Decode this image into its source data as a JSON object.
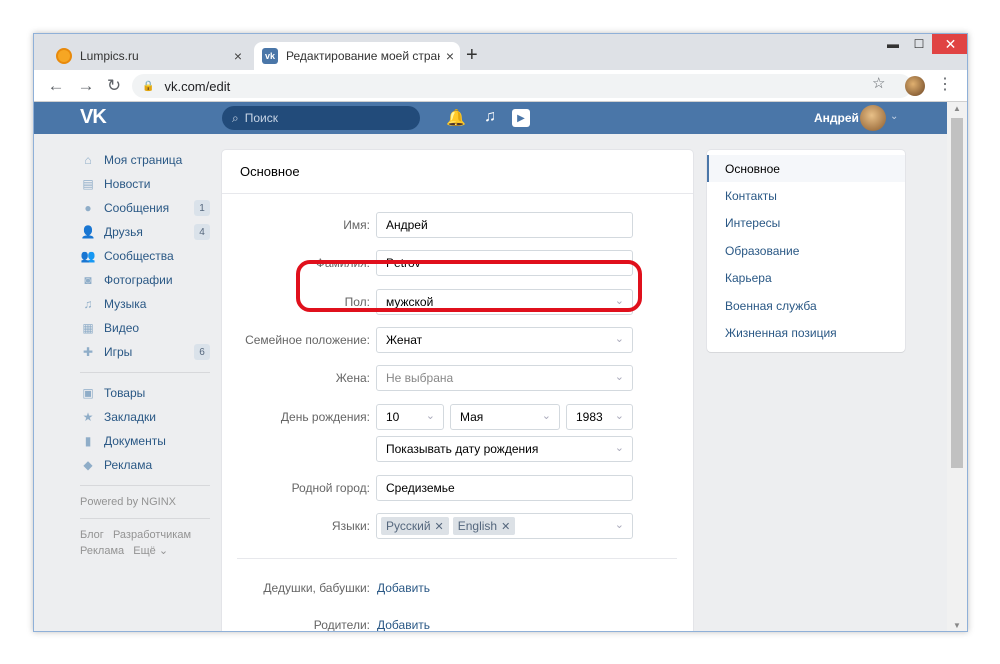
{
  "browser": {
    "tabs": [
      {
        "title": "Lumpics.ru",
        "close": "×"
      },
      {
        "title": "Редактирование моей страниц",
        "close": "×",
        "active": true
      }
    ],
    "new_tab": "+",
    "window_controls": {
      "min": "▬",
      "max": "☐",
      "close": "✕"
    },
    "nav": {
      "back": "←",
      "forward": "→",
      "reload": "↻"
    },
    "url": "vk.com/edit",
    "lock_icon": "lock-icon",
    "star": "☆",
    "menu": "⋮"
  },
  "vk_header": {
    "logo": "VK",
    "search_placeholder": "Поиск",
    "user_name": "Андрей",
    "chevron": "⌄",
    "bell": "🔔",
    "music": "♫",
    "video": "▶"
  },
  "sidebar": {
    "items": [
      {
        "label": "Моя страница",
        "icon": "home-icon",
        "glyph": "⌂"
      },
      {
        "label": "Новости",
        "icon": "news-icon",
        "glyph": "▤"
      },
      {
        "label": "Сообщения",
        "icon": "message-icon",
        "glyph": "●",
        "badge": "1"
      },
      {
        "label": "Друзья",
        "icon": "friends-icon",
        "glyph": "👤",
        "badge": "4"
      },
      {
        "label": "Сообщества",
        "icon": "groups-icon",
        "glyph": "👥"
      },
      {
        "label": "Фотографии",
        "icon": "camera-icon",
        "glyph": "◙"
      },
      {
        "label": "Музыка",
        "icon": "music-icon",
        "glyph": "♫"
      },
      {
        "label": "Видео",
        "icon": "video-icon",
        "glyph": "▦"
      },
      {
        "label": "Игры",
        "icon": "games-icon",
        "glyph": "✚",
        "badge": "6"
      }
    ],
    "items2": [
      {
        "label": "Товары",
        "icon": "shop-icon",
        "glyph": "▣"
      },
      {
        "label": "Закладки",
        "icon": "star-icon",
        "glyph": "★"
      },
      {
        "label": "Документы",
        "icon": "document-icon",
        "glyph": "▮"
      },
      {
        "label": "Реклама",
        "icon": "ads-icon",
        "glyph": "◆"
      }
    ],
    "powered": "Powered by NGINX",
    "footer_line1a": "Блог",
    "footer_line1b": "Разработчикам",
    "footer_line2a": "Реклама",
    "footer_line2b": "Ещё ⌄"
  },
  "main": {
    "title": "Основное",
    "fields": {
      "first_name": {
        "label": "Имя:",
        "value": "Андрей"
      },
      "last_name": {
        "label": "Фамилия:",
        "value": "Petrov"
      },
      "gender": {
        "label": "Пол:",
        "value": "мужской"
      },
      "marital": {
        "label": "Семейное положение:",
        "value": "Женат"
      },
      "spouse": {
        "label": "Жена:",
        "value": "Не выбрана"
      },
      "birthday": {
        "label": "День рождения:",
        "day": "10",
        "month": "Мая",
        "year": "1983",
        "visibility": "Показывать дату рождения"
      },
      "hometown": {
        "label": "Родной город:",
        "value": "Средиземье"
      },
      "languages": {
        "label": "Языки:",
        "chips": [
          "Русский",
          "English"
        ]
      },
      "grandparents": {
        "label": "Дедушки, бабушки:",
        "link": "Добавить"
      },
      "parents": {
        "label": "Родители:",
        "link": "Добавить"
      }
    },
    "dropdown_glyph": "⌄",
    "chip_remove": "✕"
  },
  "rightnav": {
    "items": [
      "Основное",
      "Контакты",
      "Интересы",
      "Образование",
      "Карьера",
      "Военная служба",
      "Жизненная позиция"
    ],
    "active_index": 0
  },
  "colors": {
    "vk_blue": "#4a76a8",
    "highlight_red": "#e0101c",
    "link": "#2a5885"
  }
}
